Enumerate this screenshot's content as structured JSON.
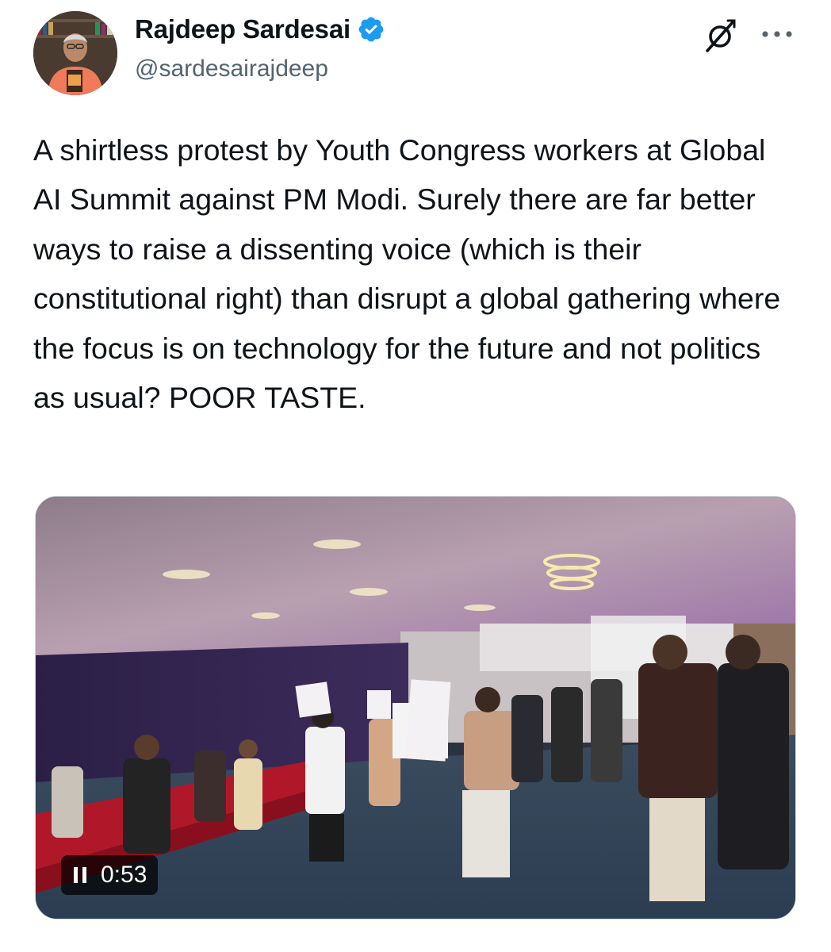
{
  "author": {
    "display_name": "Rajdeep Sardesai",
    "handle": "@sardesairajdeep",
    "verified": true,
    "avatar_icon": "profile-photo"
  },
  "actions": {
    "grok_icon": "grok-icon",
    "more_icon": "more-horizontal-icon"
  },
  "tweet": {
    "text": "A shirtless protest by Youth Congress workers at Global AI Summit against PM Modi. Surely there are far better ways to raise a dissenting voice (which is their constitutional right) than disrupt a global gathering where the focus is on technology for the future and not politics as usual? POOR TASTE."
  },
  "media": {
    "type": "video",
    "state": "playing",
    "control_icon": "pause-icon",
    "duration": "0:53"
  },
  "colors": {
    "text": "#0f1419",
    "secondary_text": "#536471",
    "verified_blue": "#1d9bf0"
  }
}
